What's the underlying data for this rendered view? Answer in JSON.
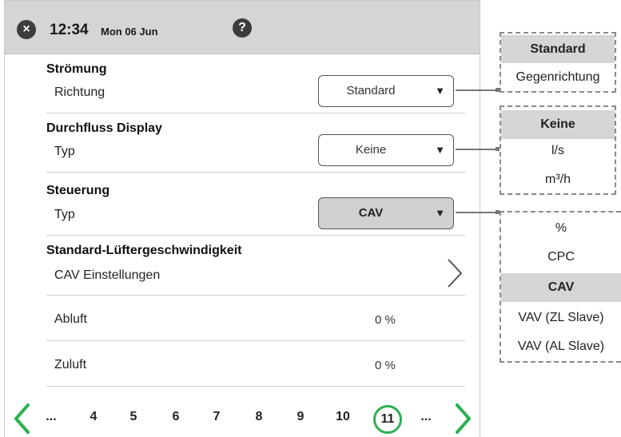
{
  "header": {
    "time": "12:34",
    "date": "Mon 06 Jun",
    "close_icon": "×",
    "help_icon": "?"
  },
  "sections": {
    "stroemung": {
      "title": "Strömung",
      "label": "Richtung",
      "value": "Standard"
    },
    "durchfluss": {
      "title": "Durchfluss Display",
      "label": "Typ",
      "value": "Keine"
    },
    "steuerung": {
      "title": "Steuerung",
      "label": "Typ",
      "value": "CAV"
    },
    "luefter": {
      "title": "Standard-Lüftergeschwindigkeit",
      "label": "CAV Einstellungen"
    },
    "abluft": {
      "label": "Abluft",
      "value": "0 %"
    },
    "zuluft": {
      "label": "Zuluft",
      "value": "0 %"
    }
  },
  "dropdown_arrow": "▼",
  "pagination": {
    "items": [
      "...",
      "4",
      "5",
      "6",
      "7",
      "8",
      "9",
      "10",
      "11",
      "..."
    ],
    "current": "11"
  },
  "popups": {
    "richtung": {
      "options": [
        "Standard",
        "Gegenrichtung"
      ],
      "selected": "Standard"
    },
    "durchfluss": {
      "options": [
        "Keine",
        "l/s",
        "m³/h"
      ],
      "selected": "Keine"
    },
    "steuerung": {
      "options": [
        "%",
        "CPC",
        "CAV",
        "VAV (ZL Slave)",
        "VAV (AL Slave)"
      ],
      "selected": "CAV"
    }
  },
  "colors": {
    "accent_green": "#2eaf52",
    "topbar": "#d5d5d5",
    "selected_option": "#d5d5d5"
  }
}
